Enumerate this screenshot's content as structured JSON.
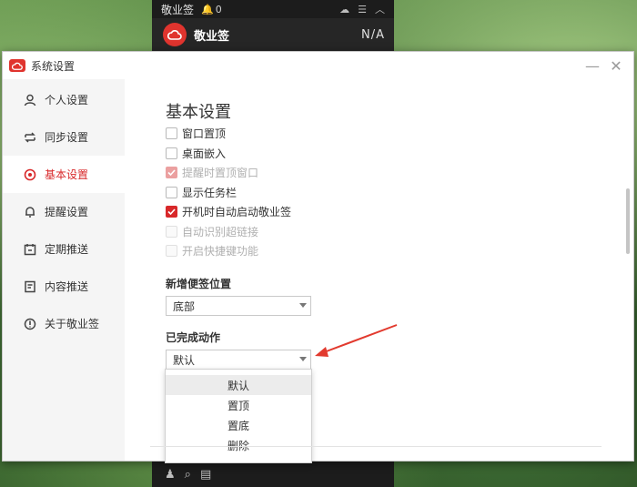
{
  "note_widget": {
    "title": "敬业签",
    "bell_count": "0",
    "icons": [
      "bell-icon",
      "cloud-icon",
      "menu-icon",
      "collapse-icon"
    ],
    "note_name": "敬业签",
    "note_status": "N/A"
  },
  "window": {
    "title": "系统设置",
    "minimize_icon": "minimize-icon",
    "close_icon": "close-icon"
  },
  "sidebar": {
    "items": [
      {
        "label": "个人设置",
        "icon": "person-icon"
      },
      {
        "label": "同步设置",
        "icon": "sync-icon"
      },
      {
        "label": "基本设置",
        "icon": "target-icon",
        "active": true
      },
      {
        "label": "提醒设置",
        "icon": "bell-icon"
      },
      {
        "label": "定期推送",
        "icon": "calendar-icon"
      },
      {
        "label": "内容推送",
        "icon": "document-icon"
      },
      {
        "label": "关于敬业签",
        "icon": "info-icon"
      }
    ]
  },
  "content": {
    "section_title": "基本设置",
    "options": [
      {
        "label": "窗口置顶",
        "state": "unchecked"
      },
      {
        "label": "桌面嵌入",
        "state": "unchecked"
      },
      {
        "label": "提醒时置顶窗口",
        "state": "checked-disabled"
      },
      {
        "label": "显示任务栏",
        "state": "unchecked"
      },
      {
        "label": "开机时自动启动敬业签",
        "state": "checked"
      },
      {
        "label": "自动识别超链接",
        "state": "disabled"
      },
      {
        "label": "开启快捷键功能",
        "state": "disabled"
      }
    ],
    "new_note_position": {
      "label": "新增便签位置",
      "value": "底部"
    },
    "completed_action": {
      "label": "已完成动作",
      "value": "默认",
      "options": [
        "默认",
        "置顶",
        "置底",
        "删除"
      ],
      "highlighted_option": "默认"
    }
  },
  "colors": {
    "accent": "#d8282a",
    "brand": "#e0342e"
  }
}
